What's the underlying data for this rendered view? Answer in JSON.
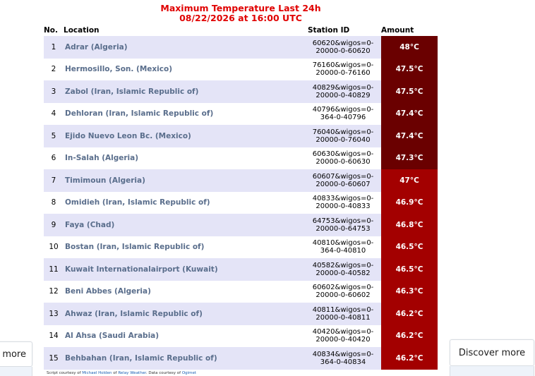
{
  "header": {
    "title": "Maximum Temperature Last 24h",
    "subtitle": "08/22/2026 at 16:00 UTC"
  },
  "table": {
    "columns": {
      "no": "No.",
      "location": "Location",
      "station": "Station ID",
      "amount": "Amount"
    },
    "rows": [
      {
        "no": "1",
        "location": "Adrar (Algeria)",
        "station_line1": "60620&wigos=0-",
        "station_line2": "20000-0-60620",
        "amount": "48°C",
        "shade": "dark"
      },
      {
        "no": "2",
        "location": "Hermosillo, Son. (Mexico)",
        "station_line1": "76160&wigos=0-",
        "station_line2": "20000-0-76160",
        "amount": "47.5°C",
        "shade": "dark"
      },
      {
        "no": "3",
        "location": "Zabol (Iran, Islamic Republic of)",
        "station_line1": "40829&wigos=0-",
        "station_line2": "20000-0-40829",
        "amount": "47.5°C",
        "shade": "dark"
      },
      {
        "no": "4",
        "location": "Dehloran (Iran, Islamic Republic of)",
        "station_line1": "40796&wigos=0-",
        "station_line2": "364-0-40796",
        "amount": "47.4°C",
        "shade": "dark"
      },
      {
        "no": "5",
        "location": "Ejido Nuevo Leon Bc. (Mexico)",
        "station_line1": "76040&wigos=0-",
        "station_line2": "20000-0-76040",
        "amount": "47.4°C",
        "shade": "dark"
      },
      {
        "no": "6",
        "location": "In-Salah (Algeria)",
        "station_line1": "60630&wigos=0-",
        "station_line2": "20000-0-60630",
        "amount": "47.3°C",
        "shade": "dark"
      },
      {
        "no": "7",
        "location": "Timimoun (Algeria)",
        "station_line1": "60607&wigos=0-",
        "station_line2": "20000-0-60607",
        "amount": "47°C",
        "shade": "red"
      },
      {
        "no": "8",
        "location": "Omidieh (Iran, Islamic Republic of)",
        "station_line1": "40833&wigos=0-",
        "station_line2": "20000-0-40833",
        "amount": "46.9°C",
        "shade": "red"
      },
      {
        "no": "9",
        "location": "Faya (Chad)",
        "station_line1": "64753&wigos=0-",
        "station_line2": "20000-0-64753",
        "amount": "46.8°C",
        "shade": "red"
      },
      {
        "no": "10",
        "location": "Bostan (Iran, Islamic Republic of)",
        "station_line1": "40810&wigos=0-",
        "station_line2": "364-0-40810",
        "amount": "46.5°C",
        "shade": "red"
      },
      {
        "no": "11",
        "location": "Kuwait Internationalairport (Kuwait)",
        "station_line1": "40582&wigos=0-",
        "station_line2": "20000-0-40582",
        "amount": "46.5°C",
        "shade": "red"
      },
      {
        "no": "12",
        "location": "Beni Abbes (Algeria)",
        "station_line1": "60602&wigos=0-",
        "station_line2": "20000-0-60602",
        "amount": "46.3°C",
        "shade": "red"
      },
      {
        "no": "13",
        "location": "Ahwaz (Iran, Islamic Republic of)",
        "station_line1": "40811&wigos=0-",
        "station_line2": "20000-0-40811",
        "amount": "46.2°C",
        "shade": "red"
      },
      {
        "no": "14",
        "location": "Al Ahsa (Saudi Arabia)",
        "station_line1": "40420&wigos=0-",
        "station_line2": "20000-0-40420",
        "amount": "46.2°C",
        "shade": "red"
      },
      {
        "no": "15",
        "location": "Behbahan (Iran, Islamic Republic of)",
        "station_line1": "40834&wigos=0-",
        "station_line2": "364-0-40834",
        "amount": "46.2°C",
        "shade": "red"
      }
    ]
  },
  "footer": {
    "prefix": "Script courtesy of ",
    "author": "Michael Holden",
    "mid1": " of ",
    "site": "Relay Weather",
    "mid2": ". Data courtesy of ",
    "source": "Ogimet"
  },
  "side": {
    "left_label": "more",
    "right_label": "Discover more"
  },
  "colors": {
    "title": "#e00000",
    "row_odd": "#e4e4f7",
    "amount_dark": "#6a0000",
    "amount_red": "#a30000",
    "location_text": "#5a6e8c"
  }
}
